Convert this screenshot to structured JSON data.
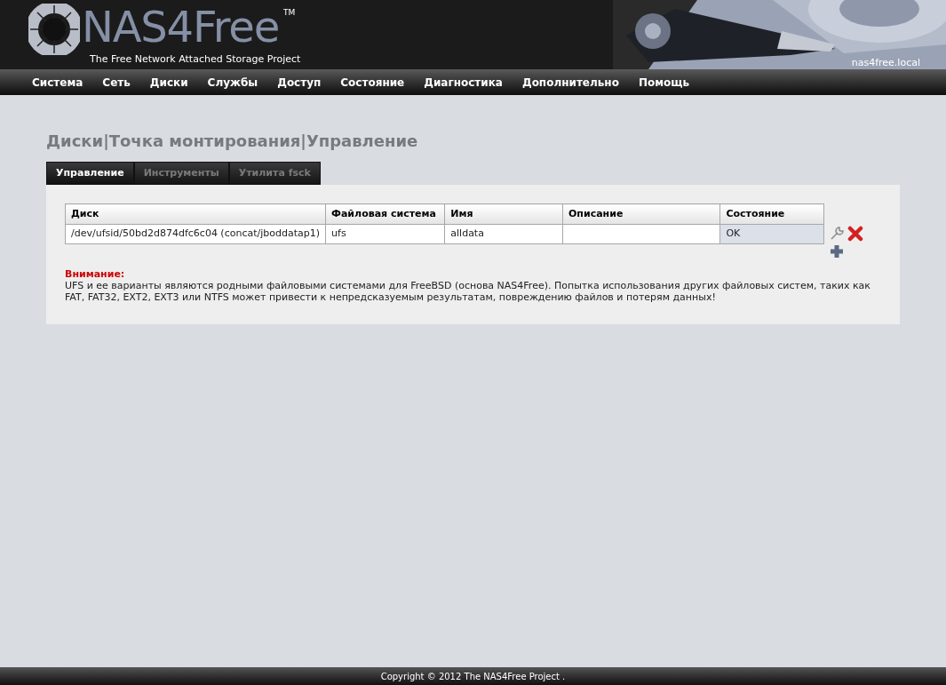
{
  "header": {
    "logo_text": "NAS4Free",
    "trademark": "TM",
    "tagline": "The Free Network Attached Storage Project",
    "hostname": "nas4free.local"
  },
  "nav": [
    {
      "label": "Система"
    },
    {
      "label": "Сеть"
    },
    {
      "label": "Диски"
    },
    {
      "label": "Службы"
    },
    {
      "label": "Доступ"
    },
    {
      "label": "Состояние"
    },
    {
      "label": "Диагностика"
    },
    {
      "label": "Дополнительно"
    },
    {
      "label": "Помощь"
    }
  ],
  "page_title": "Диски|Точка монтирования|Управление",
  "tabs": [
    {
      "label": "Управление",
      "selected": true
    },
    {
      "label": "Инструменты",
      "selected": false
    },
    {
      "label": "Утилита fsck",
      "selected": false
    }
  ],
  "table": {
    "columns": [
      "Диск",
      "Файловая система",
      "Имя",
      "Описание",
      "Состояние"
    ],
    "rows": [
      {
        "cells": [
          "/dev/ufsid/50bd2d874dfc6c04 (concat/jboddatap1)",
          "ufs",
          "alldata",
          "",
          "OK"
        ]
      }
    ]
  },
  "warning": {
    "title": "Внимание:",
    "text": "UFS и ее варианты являются родными файловыми системами для FreeBSD (основа NAS4Free). Попытка использования других файловых систем, таких как FAT, FAT32, EXT2, EXT3 или NTFS может привести к непредсказуемым результатам, повреждению файлов и потерям данных!"
  },
  "footer": "Copyright © 2012 The NAS4Free Project ."
}
